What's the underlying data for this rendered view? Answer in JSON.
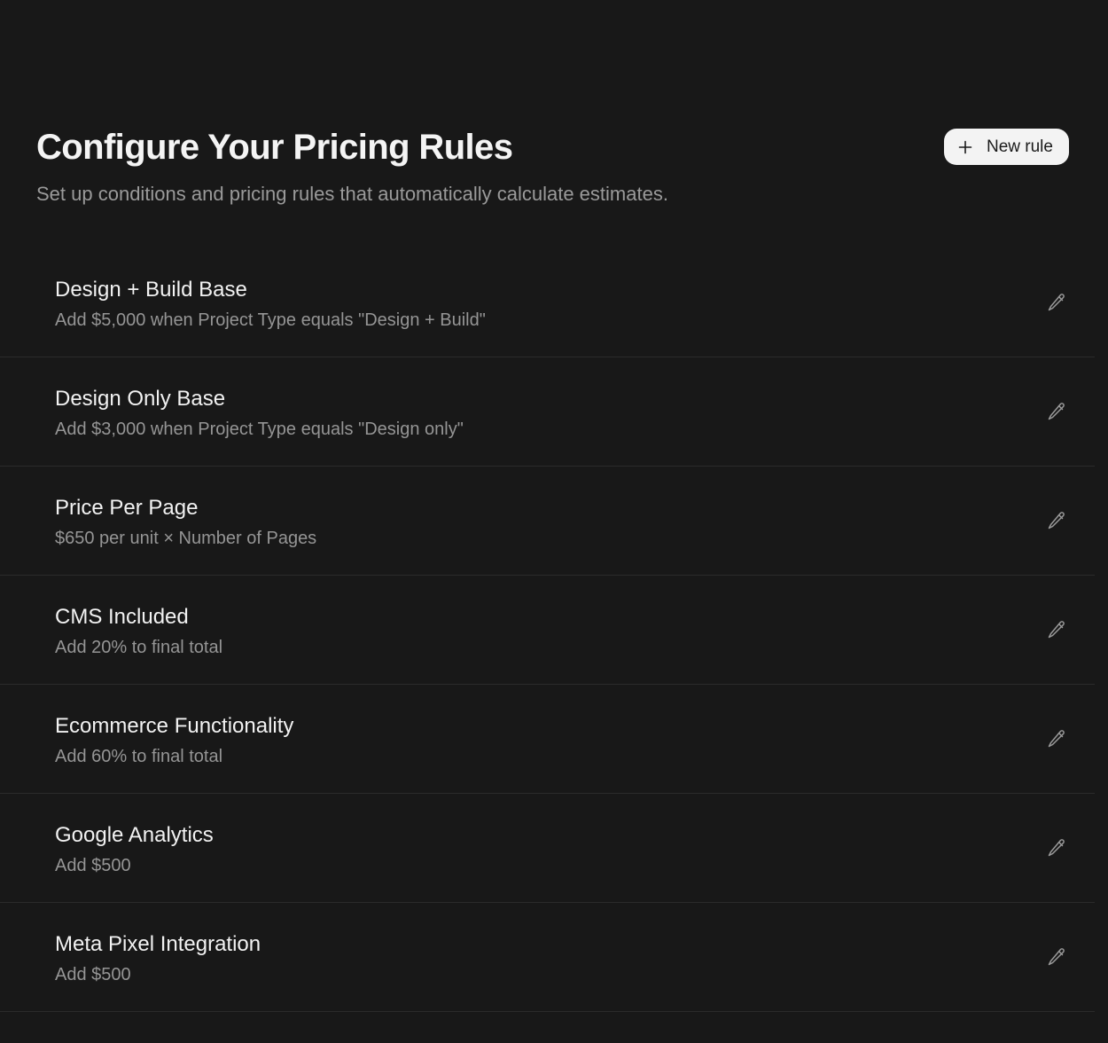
{
  "header": {
    "title": "Configure Your Pricing Rules",
    "subtitle": "Set up conditions and pricing rules that automatically calculate estimates.",
    "new_rule_label": "New rule",
    "new_rule_icon": "plus-icon"
  },
  "rules": [
    {
      "name": "Design + Build Base",
      "description": "Add $5,000 when Project Type equals \"Design + Build\"",
      "action_icon": "pencil-icon"
    },
    {
      "name": "Design Only Base",
      "description": "Add $3,000 when Project Type equals \"Design only\"",
      "action_icon": "pencil-icon"
    },
    {
      "name": "Price Per Page",
      "description": "$650 per unit × Number of Pages",
      "action_icon": "pencil-icon"
    },
    {
      "name": "CMS Included",
      "description": "Add 20% to final total",
      "action_icon": "pencil-icon"
    },
    {
      "name": "Ecommerce Functionality",
      "description": "Add 60% to final total",
      "action_icon": "pencil-icon"
    },
    {
      "name": "Google Analytics",
      "description": "Add $500",
      "action_icon": "pencil-icon"
    },
    {
      "name": "Meta Pixel Integration",
      "description": "Add $500",
      "action_icon": "pencil-icon"
    }
  ],
  "colors": {
    "background": "#181818",
    "title": "#f4f4f4",
    "subtitle": "#9a9a9a",
    "button_bg": "#f3f3f3",
    "button_text": "#1a1a1a",
    "divider": "#2b2b2b",
    "icon": "#9a9a9a"
  }
}
